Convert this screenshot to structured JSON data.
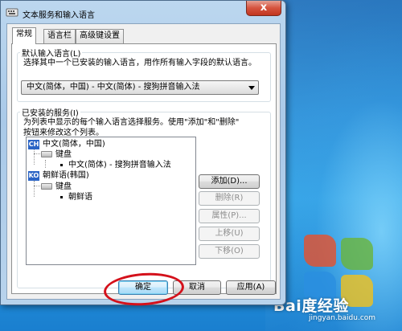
{
  "window": {
    "title": "文本服务和输入语言",
    "close_symbol": "x"
  },
  "tabs": [
    {
      "label": "常规",
      "active": true
    },
    {
      "label": "语言栏",
      "active": false
    },
    {
      "label": "高级键设置",
      "active": false
    }
  ],
  "default_language": {
    "group_label": "默认输入语言(L)",
    "description": "选择其中一个已安装的输入语言，用作所有输入字段的默认语言。",
    "selected": "中文(简体，中国) - 中文(简体) - 搜狗拼音输入法"
  },
  "installed_services": {
    "group_label": "已安装的服务(I)",
    "description_line1": "为列表中显示的每个输入语言选择服务。使用\"添加\"和\"删除\"",
    "description_line2": "按钮来修改这个列表。",
    "tree": [
      {
        "badge": "CH",
        "label": "中文(简体，中国)",
        "category": "键盘",
        "service": "中文(简体) - 搜狗拼音输入法"
      },
      {
        "badge": "KO",
        "label": "朝鲜语(韩国)",
        "category": "键盘",
        "service": "朝鲜语"
      }
    ],
    "buttons": {
      "add": "添加(D)...",
      "remove": "删除(R)",
      "properties": "属性(P)...",
      "move_up": "上移(U)",
      "move_down": "下移(O)"
    }
  },
  "footer_buttons": {
    "ok": "确定",
    "cancel": "取消",
    "apply": "应用(A)"
  },
  "watermark": {
    "brand": "Bai度经验",
    "sub": "jingyan.baidu.com"
  },
  "colors": {
    "selection_badge": "#2b64c5",
    "annotation_circle": "#d4111b"
  }
}
